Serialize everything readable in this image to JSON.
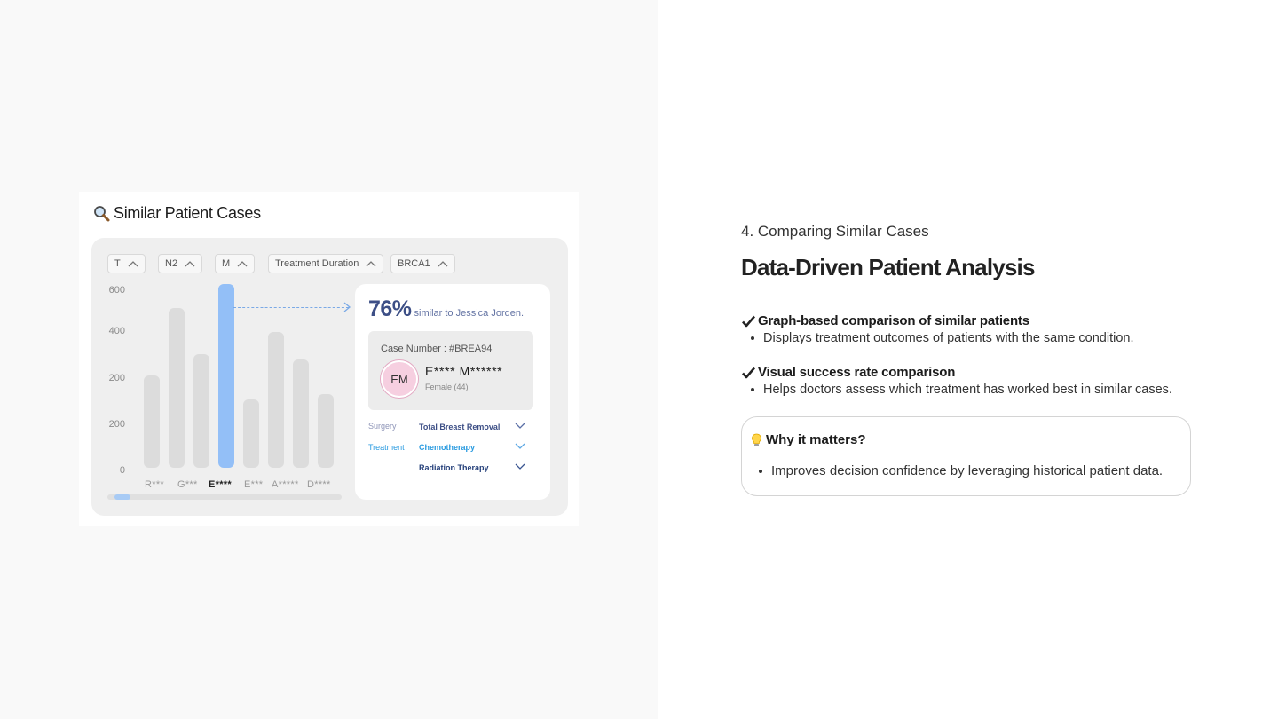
{
  "mockup": {
    "title": "Similar Patient Cases",
    "filters": [
      "T",
      "N2",
      "M",
      "Treatment Duration",
      "BRCA1"
    ],
    "match": {
      "percent": "76%",
      "text": "similar to Jessica Jorden."
    },
    "case": {
      "case_number": "Case Number : #BREA94",
      "initials": "EM",
      "name": "E**** M******",
      "meta": "Female (44)"
    },
    "treatment": {
      "surgery_label": "Surgery",
      "surgery_value": "Total Breast Removal",
      "treatment_label": "Treatment",
      "treatment_values": [
        "Chemotherapy",
        "Radiation Therapy"
      ]
    },
    "colors": {
      "accent_bar": "#93bff7",
      "neutral_bar": "#dcdcdc",
      "percent_text": "#3d4f86",
      "treatment_label": "#2a9be0"
    }
  },
  "chart_data": {
    "type": "bar",
    "y_ticks": [
      "600",
      "400",
      "200",
      "200",
      "0"
    ],
    "categories": [
      "R***",
      "G***",
      "E****",
      "E***",
      "A*****",
      "D****"
    ],
    "highlighted_category": "E****",
    "bar_heights_relative": [
      0.5,
      0.87,
      0.62,
      1.0,
      0.37,
      0.74,
      0.59,
      0.4
    ],
    "highlight_index": 3,
    "ylim": [
      0,
      600
    ],
    "grid": false
  },
  "section": {
    "eyebrow": "4. Comparing Similar Cases",
    "headline": "Data-Driven Patient Analysis"
  },
  "features": [
    {
      "title": "Graph-based comparison of similar patients",
      "desc": "Displays treatment outcomes of patients with the same condition."
    },
    {
      "title": "Visual success rate comparison",
      "desc": "Helps doctors assess which treatment has worked best in similar cases."
    }
  ],
  "why": {
    "title": "Why it matters?",
    "item": "Improves decision confidence by leveraging historical patient data."
  }
}
